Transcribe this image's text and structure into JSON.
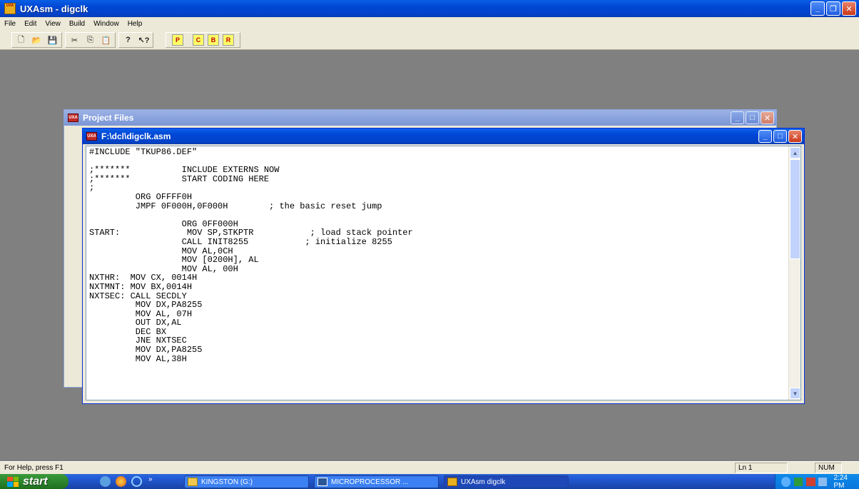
{
  "app": {
    "title": "UXAsm - digclk",
    "icon_text": "UXA"
  },
  "menu": [
    "File",
    "Edit",
    "View",
    "Build",
    "Window",
    "Help"
  ],
  "toolbar": {
    "icons": [
      "new-icon",
      "open-icon",
      "save-icon",
      "cut-icon",
      "copy-icon",
      "paste-icon",
      "help-icon",
      "context-help-icon"
    ],
    "build_buttons": [
      "P",
      "C",
      "B",
      "R"
    ]
  },
  "project_window": {
    "title": "Project Files",
    "icon_text": "UXA"
  },
  "asm_window": {
    "title": "F:\\dcl\\digclk.asm",
    "icon_text": "UXA"
  },
  "code_lines": [
    "#INCLUDE \"TKUP86.DEF\"",
    "",
    ";*******          INCLUDE EXTERNS NOW",
    ";*******          START CODING HERE",
    ";",
    "         ORG OFFFF0H",
    "         JMPF 0F000H,0F000H        ; the basic reset jump",
    "",
    "                  ORG 0FF000H",
    "START:             MOV SP,STKPTR           ; load stack pointer",
    "                  CALL INIT8255           ; initialize 8255",
    "                  MOV AL,0CH",
    "                  MOV [0200H], AL",
    "                  MOV AL, 00H",
    "NXTHR:  MOV CX, 0014H",
    "NXTMNT: MOV BX,0014H",
    "NXTSEC: CALL SECDLY",
    "         MOV DX,PA8255",
    "         MOV AL, 07H",
    "         OUT DX,AL",
    "         DEC BX",
    "         JNE NXTSEC",
    "         MOV DX,PA8255",
    "         MOV AL,38H"
  ],
  "status": {
    "help": "For Help, press F1",
    "line": "Ln  1",
    "num": "NUM"
  },
  "taskbar": {
    "start": "start",
    "chevron": "»",
    "items": [
      "KINGSTON (G:)",
      "MICROPROCESSOR ...",
      "UXAsm  digclk"
    ],
    "clock": "2:24 PM"
  },
  "colors": {
    "desktop": "#808080",
    "titlebar": "#0046d5",
    "start": "#2f8a2f"
  }
}
